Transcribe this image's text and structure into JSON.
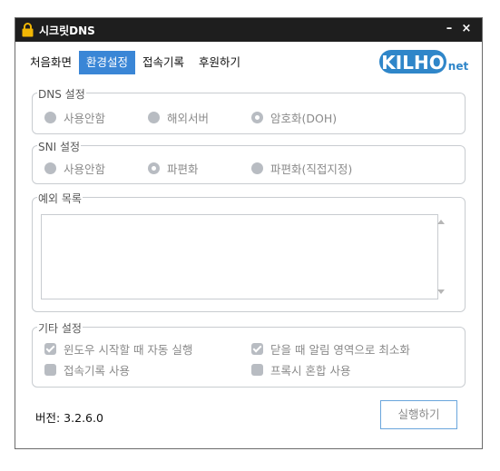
{
  "window": {
    "title": "시크릿DNS",
    "title_icon": "lock-icon",
    "minimize": "–",
    "close": "×"
  },
  "tabs": [
    {
      "label": "처음화면",
      "active": false
    },
    {
      "label": "환경설정",
      "active": true
    },
    {
      "label": "접속기록",
      "active": false
    },
    {
      "label": "후원하기",
      "active": false
    }
  ],
  "logo": {
    "text_main": "KILHO",
    "text_sub": "net",
    "color": "#2f86c9"
  },
  "dns": {
    "legend": "DNS 설정",
    "options": [
      {
        "label": "사용안함",
        "selected": false
      },
      {
        "label": "해외서버",
        "selected": false
      },
      {
        "label": "암호화(DOH)",
        "selected": true
      }
    ]
  },
  "sni": {
    "legend": "SNI 설정",
    "options": [
      {
        "label": "사용안함",
        "selected": false
      },
      {
        "label": "파편화",
        "selected": true
      },
      {
        "label": "파편화(직접지정)",
        "selected": false
      }
    ]
  },
  "exceptions": {
    "legend": "예외 목록",
    "value": ""
  },
  "etc": {
    "legend": "기타 설정",
    "checks": [
      {
        "label": "윈도우 시작할 때 자동 실행",
        "checked": true
      },
      {
        "label": "닫을 때 알림 영역으로 최소화",
        "checked": true
      },
      {
        "label": "접속기록 사용",
        "checked": false
      },
      {
        "label": "프록시 혼합 사용",
        "checked": false
      }
    ]
  },
  "footer": {
    "version": "버전: 3.2.6.0",
    "run_label": "실행하기"
  },
  "colors": {
    "accent": "#3a86d6",
    "titlebar": "#1e1e1e",
    "disabled": "#b8bcc2"
  }
}
